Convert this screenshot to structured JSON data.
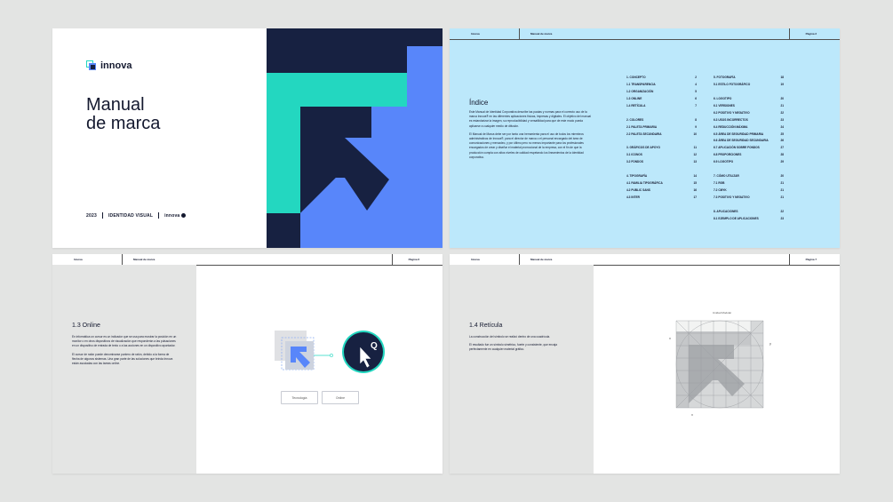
{
  "cover": {
    "brand": "innova",
    "title_line1": "Manual",
    "title_line2": "de marca",
    "year": "2023",
    "subtitle": "IDENTIDAD VISUAL",
    "brand_small": "innova",
    "colors": {
      "navy": "#172141",
      "teal": "#23d7c0",
      "blue": "#5886fa"
    }
  },
  "index_page": {
    "header": {
      "left": "Innova",
      "middle": "Manual de marca",
      "right": "Página 2"
    },
    "title": "Índice",
    "paragraph1": "Este Manual de Identidad Corporativa describe las pautas y normas para el correcto uso de la marca Innova® en las diferentes aplicaciones físicas, impresas y digitales. El objetivo del manual es estandarizar la imagen, su reproducibilidad y versatilidad para que de este modo pueda aplicarse a cualquier medio de difusión.",
    "paragraph2": "El Manual de Marca debe ser por tanto una herramienta para el uso de todos los miembros administrativos de Innova®, para el director de marca o el personal encargado del área de comunicaciones y mercadeo, y por último pero no menos importante para los profesionales encargados de crear y diseñar el material promocional de la empresa, con el fin de que la producción cumpla con altos niveles de calidad respetando los lineamientos de la identidad corporativa.",
    "toc_left": [
      {
        "label": "1. CONCEPTO",
        "page": "2"
      },
      {
        "label": "1.1 TRANSPARENCIA",
        "page": "4"
      },
      {
        "label": "1.2 ORGANIZACIÓN",
        "page": "5"
      },
      {
        "label": "1.3 ONLINE",
        "page": "6"
      },
      {
        "label": "1.4 RETÍCULA",
        "page": "7"
      },
      {
        "label": "",
        "page": ""
      },
      {
        "label": "2. COLORES",
        "page": "8"
      },
      {
        "label": "2.1 PALETA PRIMARIA",
        "page": "9"
      },
      {
        "label": "2.2 PALETA SECUNDARIA",
        "page": "10"
      },
      {
        "label": "",
        "page": ""
      },
      {
        "label": "3. GRÁFICOS DE APOYO",
        "page": "11"
      },
      {
        "label": "3.1 ICONOS",
        "page": "12"
      },
      {
        "label": "3.2 FONDOS",
        "page": "13"
      },
      {
        "label": "",
        "page": ""
      },
      {
        "label": "4. TIPOGRAFÍA",
        "page": "14"
      },
      {
        "label": "4.1 FAMILIA TIPOGRÁFICA",
        "page": "15"
      },
      {
        "label": "4.2 PUBLIC SANS",
        "page": "16"
      },
      {
        "label": "4.3 INTER",
        "page": "17"
      }
    ],
    "toc_right": [
      {
        "label": "5. FOTOGRAFÍA",
        "page": "18"
      },
      {
        "label": "5.1 ESTILO FOTOGRÁFICO",
        "page": "19"
      },
      {
        "label": "",
        "page": ""
      },
      {
        "label": "6. LOGOTIPO",
        "page": "20"
      },
      {
        "label": "6.1 VERSIONES",
        "page": "21"
      },
      {
        "label": "6.2 POSITIVO Y NEGATIVO",
        "page": "22"
      },
      {
        "label": "6.3 USOS INCORRECTOS",
        "page": "23"
      },
      {
        "label": "6.4 REDUCCIÓN MÁXIMA",
        "page": "24"
      },
      {
        "label": "6.5 ÁREA DE SEGURIDAD PRIMARIA",
        "page": "25"
      },
      {
        "label": "6.6 ÁREA DE SEGURIDAD SECUNDARIA",
        "page": "26"
      },
      {
        "label": "6.7 APLICACIÓN SOBRE FONDOS",
        "page": "27"
      },
      {
        "label": "6.8 PROPORCIONES",
        "page": "28"
      },
      {
        "label": "6.9 LOGOTIPO",
        "page": "29"
      },
      {
        "label": "",
        "page": ""
      },
      {
        "label": "7. CÓMO UTILIZAR",
        "page": "20"
      },
      {
        "label": "7.1 RGB",
        "page": "21"
      },
      {
        "label": "7.2 CMYK",
        "page": "21"
      },
      {
        "label": "7.3 POSITIVO Y NEGATIVO",
        "page": "21"
      },
      {
        "label": "",
        "page": ""
      },
      {
        "label": "8. APLICACIONES",
        "page": "22"
      },
      {
        "label": "8.1 EJEMPLO DE APLICACIONES",
        "page": "23"
      }
    ]
  },
  "online_page": {
    "header": {
      "left": "Innova",
      "middle": "Manual de marca",
      "right": "Página 6"
    },
    "title": "1.3 Online",
    "paragraph1": "En informática un cursor es un indicador que se usa para mostrar la posición en un monitor o en otros dispositivos de visualización que responderán a las pulsaciones en un dispositivo de entrada de texto o a las acciones en un dispositivo apuntador.",
    "paragraph2": "El cursor de ratón puede denominarse puntero de ratón, debido a la forma de flecha de algunos sistemas. Una gran parte de las soluciones que brinda Innova están asociadas con las tareas online.",
    "chip1": "Tecnología",
    "chip2": "Online",
    "zoom_glyph": "Q"
  },
  "grid_page": {
    "header": {
      "left": "Innova",
      "middle": "Manual de marca",
      "right": "Página 7"
    },
    "title": "1.4 Retícula",
    "paragraph1": "La construcción del símbolo se realizó dentro de una cuadrícula.",
    "paragraph2": "El resultado fue un símbolo simétrico, fuerte y consistente, que encaja perfectamente en cualquier material gráfico.",
    "grid_caption": "Unidad Modular",
    "axis_x": "x",
    "axis_y": "y"
  }
}
